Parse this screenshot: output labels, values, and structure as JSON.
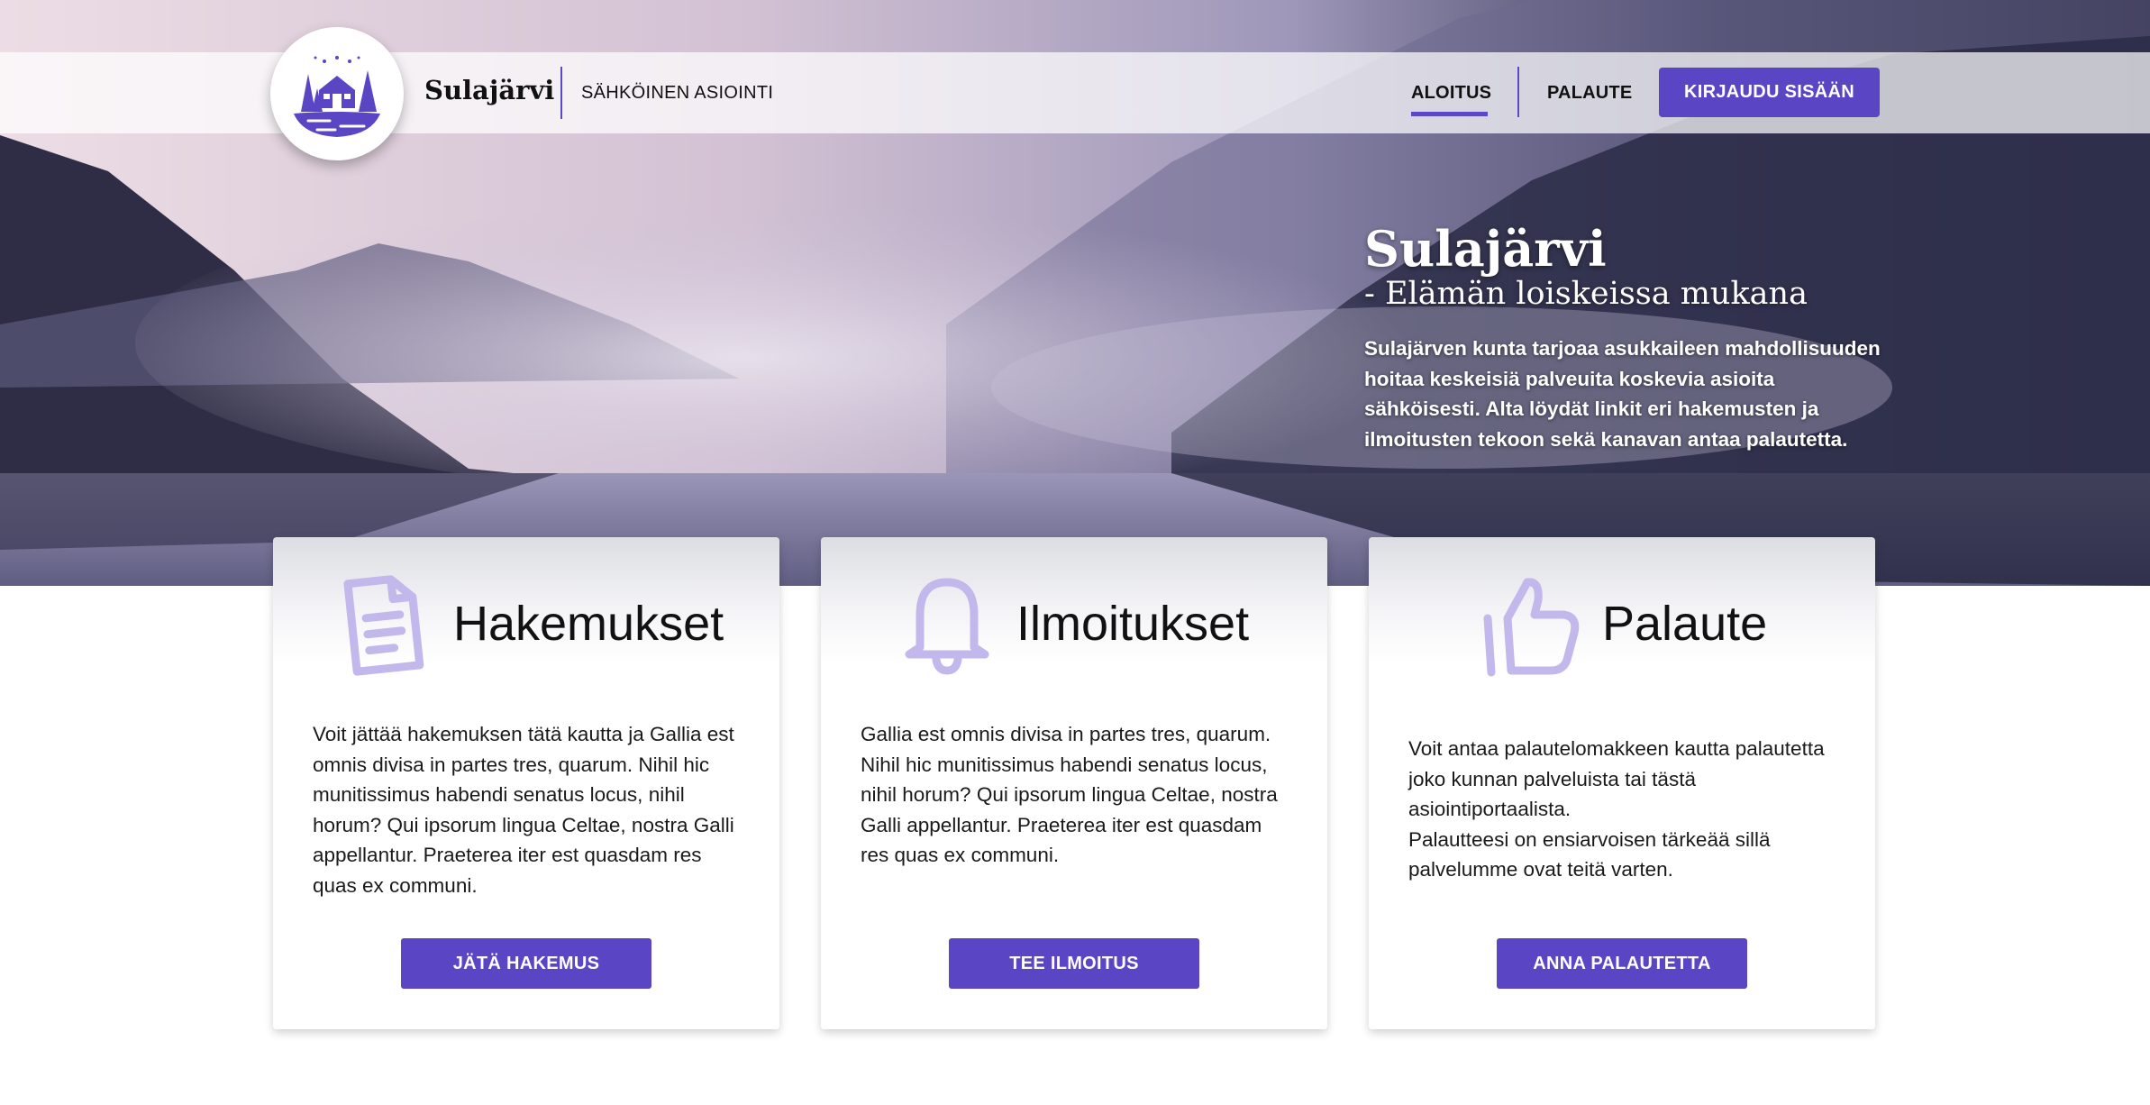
{
  "colors": {
    "accent": "#5a46c5",
    "icon": "#c2b8ec",
    "text": "#111111"
  },
  "header": {
    "brand_name": "Sulajärvi",
    "brand_subtitle": "SÄHKÖINEN ASIOINTI",
    "nav": {
      "home": "ALOITUS",
      "feedback": "PALAUTE",
      "login": "KIRJAUDU SISÄÄN"
    },
    "logo_icon": "lake-cabin-logo"
  },
  "hero": {
    "title": "Sulajärvi",
    "subtitle": "- Elämän loiskeissa mukana",
    "text": "Sulajärven kunta tarjoaa asukkaileen mahdollisuuden hoitaa keskeisiä palveuita koskevia asioita sähköisesti. Alta löydät linkit eri hakemusten ja ilmoitusten tekoon sekä kanavan antaa palautetta."
  },
  "cards": [
    {
      "icon": "document-icon",
      "title": "Hakemukset",
      "text": "Voit jättää hakemuksen tätä kautta ja Gallia est omnis divisa in partes tres, quarum. Nihil hic munitissimus habendi senatus locus, nihil horum? Qui ipsorum lingua Celtae, nostra Galli appellantur. Praeterea iter est quasdam res quas ex communi.",
      "button": "JÄTÄ HAKEMUS"
    },
    {
      "icon": "bell-icon",
      "title": "Ilmoitukset",
      "text": "Gallia est omnis divisa in partes tres, quarum. Nihil hic munitissimus habendi senatus locus, nihil horum? Qui ipsorum lingua Celtae, nostra Galli appellantur. Praeterea iter est quasdam res quas ex communi.",
      "button": "TEE ILMOITUS"
    },
    {
      "icon": "thumbs-up-icon",
      "title": "Palaute",
      "text_line1": "Voit antaa palautelomakkeen kautta palautetta joko kunnan palveluista tai tästä asiointiportaalista.",
      "text_line2": "Palautteesi on ensiarvoisen tärkeää sillä palvelumme ovat teitä varten.",
      "button": "ANNA PALAUTETTA"
    }
  ]
}
